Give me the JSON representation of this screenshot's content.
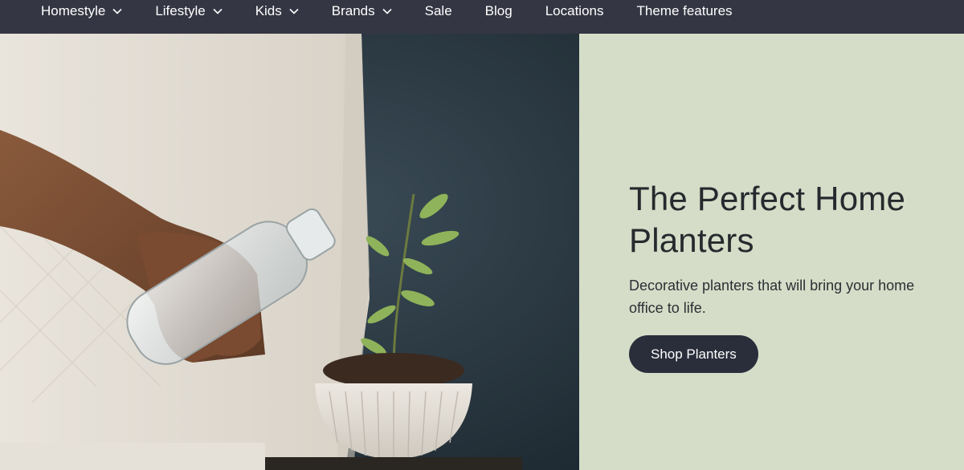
{
  "nav": {
    "items": [
      {
        "label": "Homestyle",
        "has_dropdown": true
      },
      {
        "label": "Lifestyle",
        "has_dropdown": true
      },
      {
        "label": "Kids",
        "has_dropdown": true
      },
      {
        "label": "Brands",
        "has_dropdown": true
      },
      {
        "label": "Sale",
        "has_dropdown": false
      },
      {
        "label": "Blog",
        "has_dropdown": false
      },
      {
        "label": "Locations",
        "has_dropdown": false
      },
      {
        "label": "Theme features",
        "has_dropdown": false
      }
    ],
    "background": "#343643"
  },
  "hero": {
    "title": "The Perfect Home Planters",
    "description": "Decorative planters that will bring your home office to life.",
    "cta_label": "Shop Planters",
    "panel_color": "#d5ddc8",
    "cta_color": "#2a2d3a"
  }
}
